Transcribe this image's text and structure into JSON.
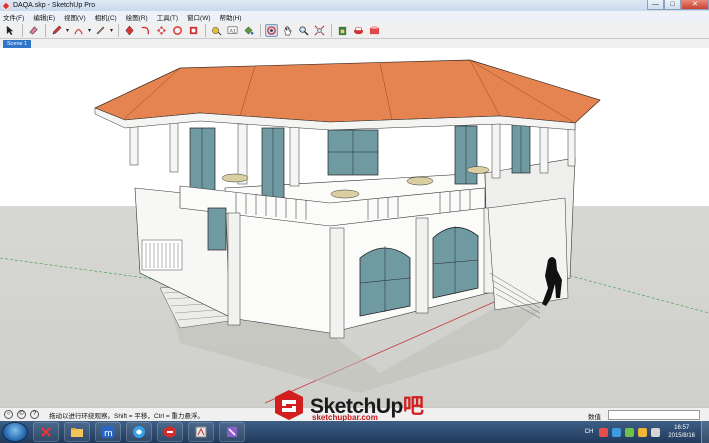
{
  "window": {
    "title": "DAQA.skp - SketchUp Pro",
    "controls": {
      "minimize": "—",
      "maximize": "□",
      "close": "✕"
    }
  },
  "menu": {
    "items": [
      "文件(F)",
      "编辑(E)",
      "视图(V)",
      "相机(C)",
      "绘图(R)",
      "工具(T)",
      "窗口(W)",
      "帮助(H)"
    ]
  },
  "toolbar": {
    "tools": [
      "select-icon",
      "eraser-icon",
      "pencil-icon",
      "arc-icon",
      "rectangle-icon",
      "push-pull-icon",
      "follow-me-icon",
      "move-icon",
      "rotate-icon",
      "offset-icon",
      "tape-measure-icon",
      "text-icon",
      "paint-bucket-icon",
      "orbit-icon",
      "pan-icon",
      "zoom-icon",
      "zoom-extents-icon",
      "warehouse-icon",
      "extension-warehouse-icon",
      "layout-icon"
    ],
    "active_tool": "orbit-icon"
  },
  "scenes": {
    "tabs": [
      "Scene 1"
    ]
  },
  "status": {
    "hint": "拖动以进行环绕观察。Shift = 平移，Ctrl = 重力悬浮。",
    "measurements_label": "数值",
    "measurements_value": ""
  },
  "logo": {
    "word": "SketchUp",
    "accent": "吧",
    "url": "sketchupbar.com"
  },
  "taskbar": {
    "apps": [
      "close-app-icon",
      "explorer-icon",
      "maxthon-icon",
      "browser-icon",
      "sketchup-icon",
      "app-icon",
      "app2-icon"
    ],
    "lang": "CH",
    "time": "16:57",
    "date": "2015/8/16"
  },
  "colors": {
    "roof": "#e58450",
    "wall": "#f8f8f8",
    "glass": "#6f9aa2",
    "ground": "#d3d3cf",
    "accent": "#d21e1e"
  }
}
